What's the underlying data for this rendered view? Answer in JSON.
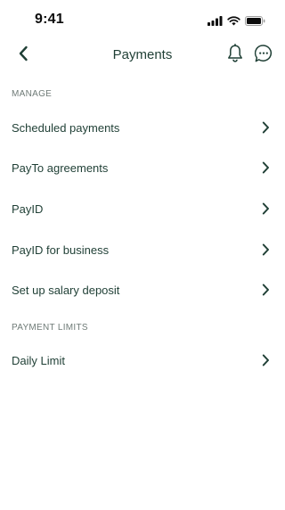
{
  "status_bar": {
    "time": "9:41",
    "icons": [
      "signal-icon",
      "wifi-icon",
      "battery-icon"
    ]
  },
  "header": {
    "title": "Payments",
    "back_icon": "chevron-left-icon",
    "notification_icon": "bell-icon",
    "chat_icon": "chat-bubble-icon"
  },
  "sections": {
    "manage": {
      "label": "MANAGE",
      "items": [
        {
          "label": "Scheduled payments"
        },
        {
          "label": "PayTo agreements"
        },
        {
          "label": "PayID"
        },
        {
          "label": "PayID for business"
        },
        {
          "label": "Set up salary deposit"
        }
      ]
    },
    "payment_limits": {
      "label": "PAYMENT LIMITS",
      "items": [
        {
          "label": "Daily Limit"
        }
      ]
    }
  },
  "colors": {
    "primary_text": "#1f3f35",
    "section_label": "#6f7b77",
    "icon": "#1f3f35",
    "background": "#ffffff"
  }
}
